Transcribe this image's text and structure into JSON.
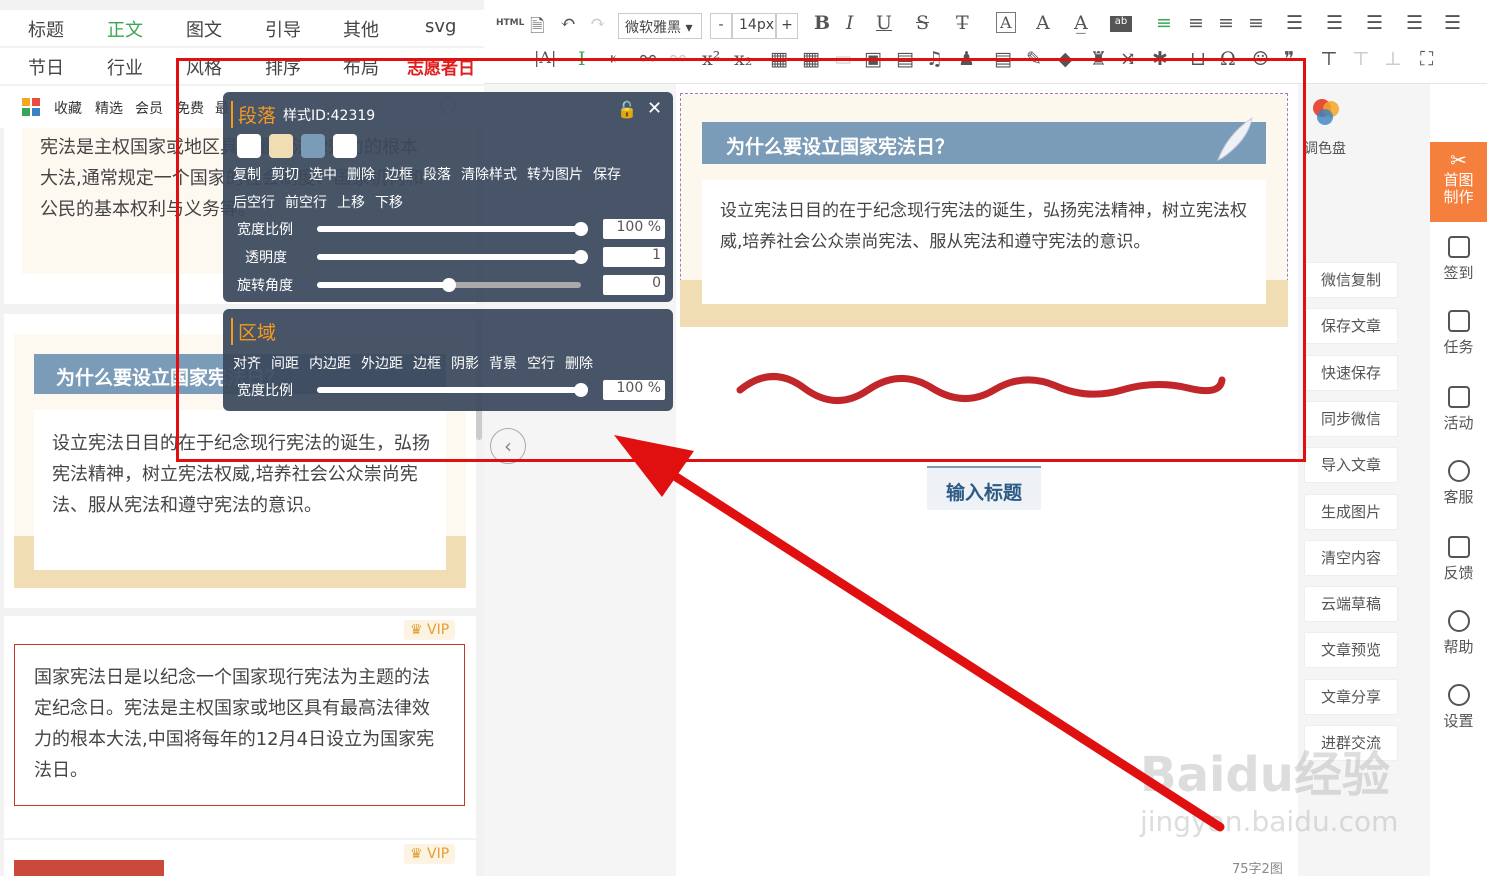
{
  "nav": {
    "row1": [
      "标题",
      "正文",
      "图文",
      "引导",
      "其他",
      "svg"
    ],
    "row2": [
      "节日",
      "行业",
      "风格",
      "排序",
      "布局",
      "志愿者日"
    ],
    "active": "正文"
  },
  "filters": [
    "收藏",
    "精选",
    "会员",
    "免费",
    "最"
  ],
  "left_cards": {
    "card1_text": "宪法是主权国家或地区具有最高法律效力的根本大法,通常规定一个国家的社会制度、国家机构和公民的基本权利与义务等。",
    "card2_title": "为什么要设立国家宪法日？",
    "card2_text": "设立宪法日目的在于纪念现行宪法的诞生，弘扬宪法精神，树立宪法权威,培养社会公众崇尚宪法、服从宪法和遵守宪法的意识。",
    "vip_label": "VIP",
    "card3_text": "国家宪法日是以纪念一个国家现行宪法为主题的法定纪念日。宪法是主权国家或地区具有最高法律效力的根本大法,中国将每年的12月4日设立为国家宪法日。"
  },
  "toolbar": {
    "html_label": "HTML",
    "font_family": "微软雅黑",
    "font_size": "14px",
    "minus": "-",
    "plus": "+",
    "bold": "B",
    "italic": "I",
    "underline": "U",
    "strike": "S",
    "omega": "Ω"
  },
  "editor": {
    "title": "为什么要设立国家宪法日？",
    "text": "设立宪法日目的在于纪念现行宪法的诞生，弘扬宪法精神，树立宪法权威,培养社会公众崇尚宪法、服从宪法和遵守宪法的意识。",
    "input_title": "输入标题",
    "count": "75字2图"
  },
  "paragraph_panel": {
    "title": "段落",
    "style_id": "样式ID:42319",
    "swatches": [
      "#ffffff",
      "#f0ddb3",
      "#7b9cb8",
      "#ffffff"
    ],
    "actions_row1": [
      "复制",
      "剪切",
      "选中",
      "删除",
      "边框",
      "段落",
      "清除样式",
      "转为图片",
      "保存"
    ],
    "actions_row2": [
      "后空行",
      "前空行",
      "上移",
      "下移"
    ],
    "sliders": [
      {
        "label": "宽度比例",
        "value": "100 %",
        "fraction": 1.0
      },
      {
        "label": "透明度",
        "value": "1",
        "fraction": 1.0
      },
      {
        "label": "旋转角度",
        "value": "0",
        "fraction": 0.5
      }
    ]
  },
  "region_panel": {
    "title": "区域",
    "actions": [
      "对齐",
      "间距",
      "内边距",
      "外边距",
      "边框",
      "阴影",
      "背景",
      "空行",
      "删除"
    ],
    "slider": {
      "label": "宽度比例",
      "value": "100 %",
      "fraction": 1.0
    }
  },
  "side_buttons": [
    "微信复制",
    "保存文章",
    "快速保存",
    "同步微信",
    "导入文章",
    "生成图片",
    "清空内容",
    "云端草稿",
    "文章预览",
    "文章分享",
    "进群交流"
  ],
  "palette_label": "调色盘",
  "right_bar": {
    "home": "首图制作",
    "items": [
      "签到",
      "任务",
      "活动",
      "客服",
      "反馈",
      "帮助",
      "设置"
    ]
  },
  "watermark": {
    "brand": "Baidu经验",
    "url": "jingyan.baidu.com"
  },
  "colors": {
    "accent": "#3aa655",
    "title_bar": "#7b9cb8",
    "annotation": "#e01010",
    "orange": "#f59a1e"
  }
}
